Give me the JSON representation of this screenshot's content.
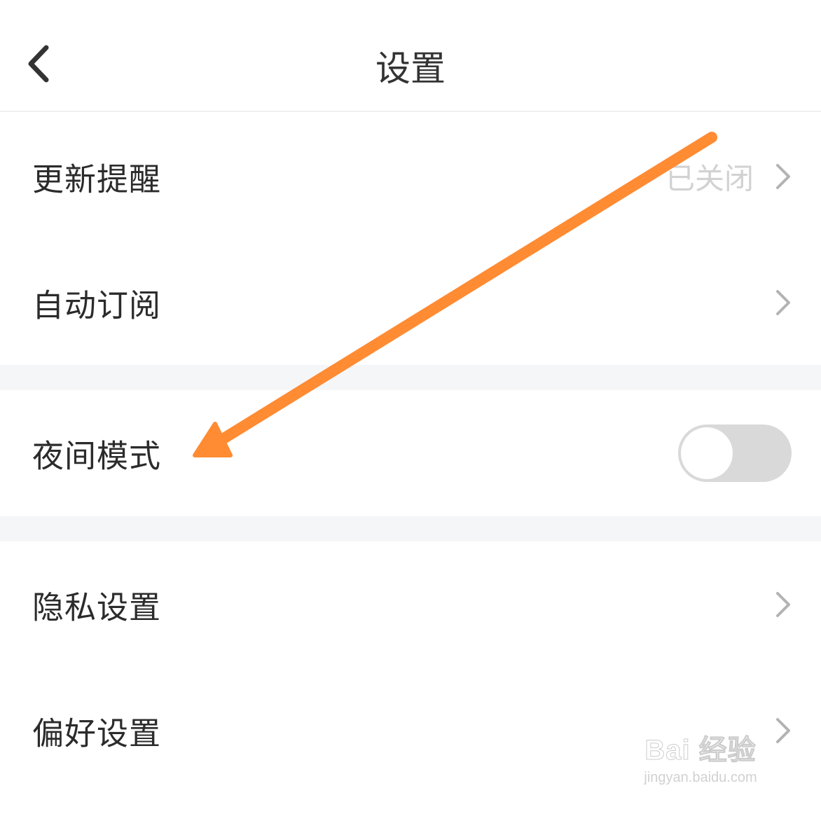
{
  "header": {
    "title": "设置",
    "back_icon": "chevron-left-icon"
  },
  "rows": [
    {
      "label": "更新提醒",
      "value": "已关闭",
      "icon": "chevron-right-icon"
    },
    {
      "label": "自动订阅",
      "icon": "chevron-right-icon"
    },
    {
      "label": "夜间模式",
      "toggle": {
        "state": "off"
      }
    },
    {
      "label": "隐私设置",
      "icon": "chevron-right-icon"
    },
    {
      "label": "偏好设置",
      "icon": "chevron-right-icon"
    }
  ],
  "colors": {
    "annotation_arrow": "#ff8b33",
    "toggle_off_track": "#d9d9d9",
    "section_gap": "#f5f6f7",
    "value_text": "#d2d2d2"
  },
  "watermark": {
    "logo": "Bai 经验",
    "url": "jingyan.baidu.com"
  }
}
